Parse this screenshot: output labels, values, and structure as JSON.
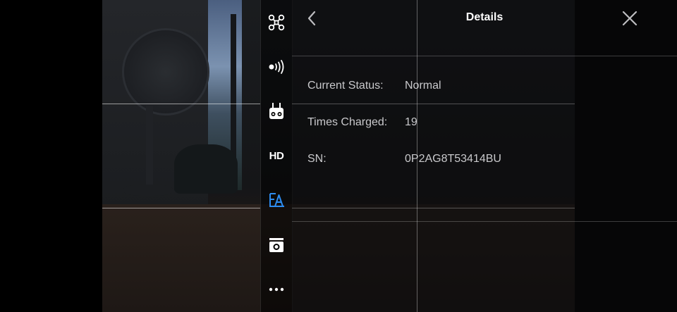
{
  "panel": {
    "title": "Details",
    "back_icon": "chevron-left-icon",
    "close_icon": "close-icon",
    "rows": [
      {
        "label": "Current Status:",
        "value": "Normal"
      },
      {
        "label": "Times Charged:",
        "value": "19"
      },
      {
        "label": "SN:",
        "value": "0P2AG8T53414BU"
      }
    ]
  },
  "sidebar": {
    "items": [
      {
        "icon": "aircraft-icon"
      },
      {
        "icon": "signal-icon"
      },
      {
        "icon": "remote-controller-icon"
      },
      {
        "icon": "hd-icon",
        "label": "HD"
      },
      {
        "icon": "battery-settings-icon",
        "active": true
      },
      {
        "icon": "camera-icon"
      },
      {
        "icon": "more-icon"
      }
    ]
  },
  "colors": {
    "accent": "#2d8cf0",
    "text_primary": "#ffffff",
    "text_secondary": "#c9c9cc"
  }
}
